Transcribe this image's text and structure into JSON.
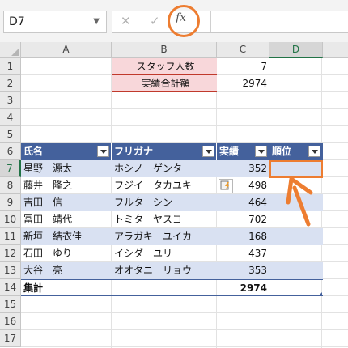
{
  "formula_bar": {
    "name_box": "D7",
    "cancel_glyph": "✕",
    "enter_glyph": "✓",
    "fx_label": "fx",
    "formula": ""
  },
  "columns": [
    "A",
    "B",
    "C",
    "D"
  ],
  "rows": [
    "1",
    "2",
    "3",
    "4",
    "5",
    "6",
    "7",
    "8",
    "9",
    "10",
    "11",
    "12",
    "13",
    "14",
    "15",
    "16",
    "17"
  ],
  "summary": {
    "staff_label": "スタッフ人数",
    "staff_value": "7",
    "total_label": "実績合計額",
    "total_value": "2974"
  },
  "table": {
    "headers": [
      "氏名",
      "フリガナ",
      "実績",
      "順位"
    ],
    "rows": [
      {
        "name": "星野　源太",
        "kana": "ホシノ　ゲンタ",
        "value": "352",
        "rank": ""
      },
      {
        "name": "藤井　隆之",
        "kana": "フジイ　タカユキ",
        "value": "498",
        "rank": ""
      },
      {
        "name": "吉田　信",
        "kana": "フルタ　シン",
        "value": "464",
        "rank": ""
      },
      {
        "name": "冨田　靖代",
        "kana": "トミタ　ヤスヨ",
        "value": "702",
        "rank": ""
      },
      {
        "name": "新垣　結衣佳",
        "kana": "アラガキ　ユイカ",
        "value": "168",
        "rank": ""
      },
      {
        "name": "石田　ゆり",
        "kana": "イシダ　ユリ",
        "value": "437",
        "rank": ""
      },
      {
        "name": "大谷　亮",
        "kana": "オオタニ　リョウ",
        "value": "353",
        "rank": ""
      }
    ],
    "total_label": "集計",
    "total_value": "2974"
  },
  "icons": {
    "paste_options": "paste-options-icon",
    "annotation_arrow": "arrow-icon"
  },
  "colors": {
    "accent": "#ed7d31",
    "table_header": "#44619c",
    "band": "#d9e1f2",
    "pink": "#f8d7da"
  }
}
